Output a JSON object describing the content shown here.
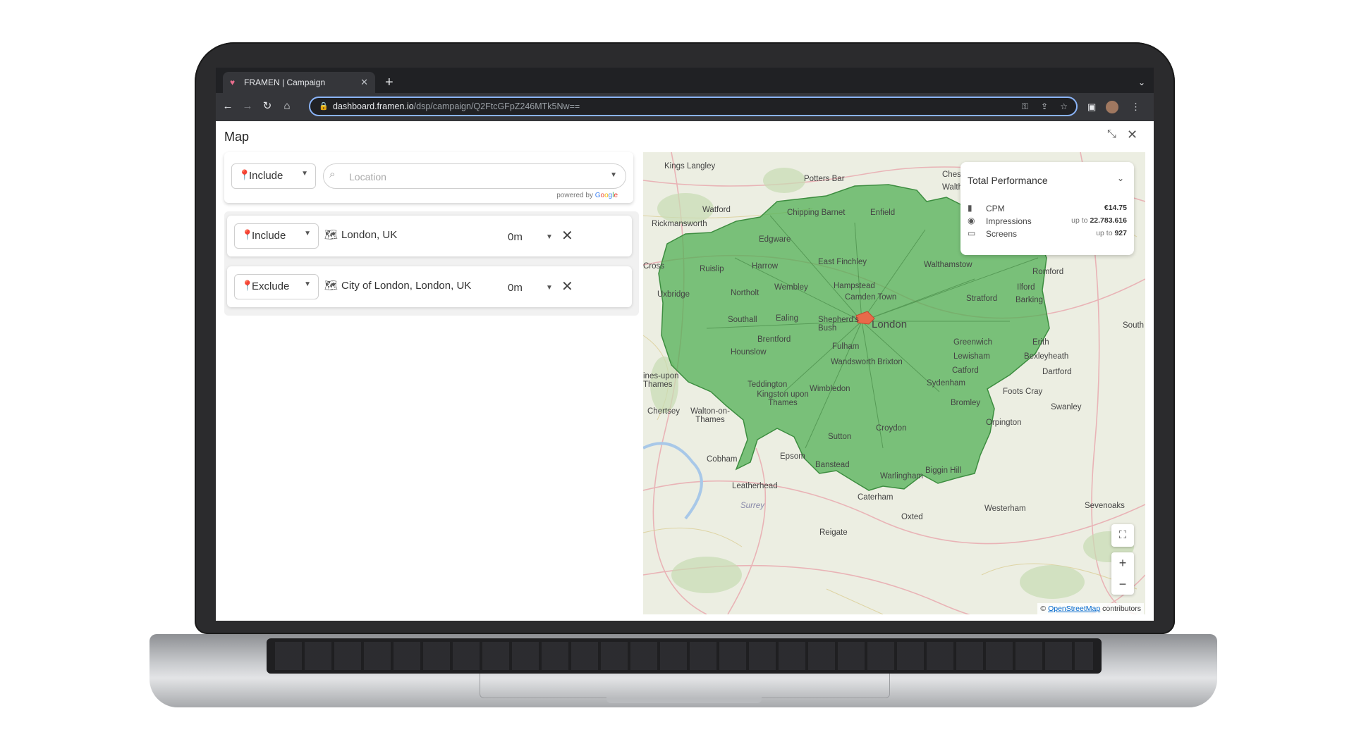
{
  "browser": {
    "tab_title": "FRAMEN | Campaign",
    "tab_close": "✕",
    "new_tab": "+",
    "tab_menu": "⌄",
    "url_host": "dashboard.framen.io",
    "url_path": "/dsp/campaign/Q2FtcGFpZ246MTk5Nw=="
  },
  "header": {
    "title": "Map",
    "collapse_icon": "⤡",
    "close_icon": "✕"
  },
  "search": {
    "mode_label": "Include",
    "placeholder": "Location",
    "powered_by": "powered by",
    "google_letters": [
      "G",
      "o",
      "o",
      "g",
      "l",
      "e"
    ]
  },
  "locations": [
    {
      "mode": "Include",
      "mode_color": "#2e8b57",
      "name": "London, UK",
      "radius": "0m"
    },
    {
      "mode": "Exclude",
      "mode_color": "#d23a3a",
      "name": "City of London, London, UK",
      "radius": "0m"
    }
  ],
  "performance": {
    "title": "Total Performance",
    "rows": [
      {
        "icon": "bar-chart-icon",
        "label": "CPM",
        "prefix": "",
        "value": "€14.75"
      },
      {
        "icon": "eye-icon",
        "label": "Impressions",
        "prefix": "up to",
        "value": "22.783.616"
      },
      {
        "icon": "monitor-icon",
        "label": "Screens",
        "prefix": "up to",
        "value": "927"
      }
    ]
  },
  "map": {
    "include_color": "#4caf50",
    "exclude_color": "#e86a4a",
    "labels": [
      "Kings Langley",
      "Potters Bar",
      "Watford",
      "Chipping Barnet",
      "Enfield",
      "Chesh",
      "Waltham",
      "Rickmansworth",
      "Edgware",
      "East Finchley",
      "Walthamstow",
      "Romford",
      "Ruislip",
      "Harrow",
      "Hampstead",
      "Ilford",
      "Wembley",
      "Camden Town",
      "Stratford",
      "Barking",
      "Northolt",
      "Uxbridge",
      "London",
      "Southall",
      "Ealing",
      "Shepherd's Bush",
      "Brentford",
      "Greenwich",
      "Erith",
      "Fulham",
      "Hounslow",
      "Lewisham",
      "Bexleyheath",
      "Wandsworth",
      "Brixton",
      "Catford",
      "Dartford",
      "Teddington",
      "Wimbledon",
      "Sydenham",
      "Kingston upon Thames",
      "Bromley",
      "Foots Cray",
      "Swanley",
      "Chertsey",
      "Walton-on-Thames",
      "Orpington",
      "Croydon",
      "Sutton",
      "Cobham",
      "Epsom",
      "Banstead",
      "Biggin Hill",
      "Leatherhead",
      "Warlingham",
      "Caterham",
      "Westerham",
      "Oxted",
      "Sevenoaks",
      "Surrey",
      "Reigate",
      "South",
      "Cross",
      "ines-upon Thames"
    ],
    "attribution_prefix": "©",
    "attribution_link": "OpenStreetMap",
    "attribution_suffix": "contributors",
    "zoom_in": "+",
    "zoom_out": "−"
  }
}
